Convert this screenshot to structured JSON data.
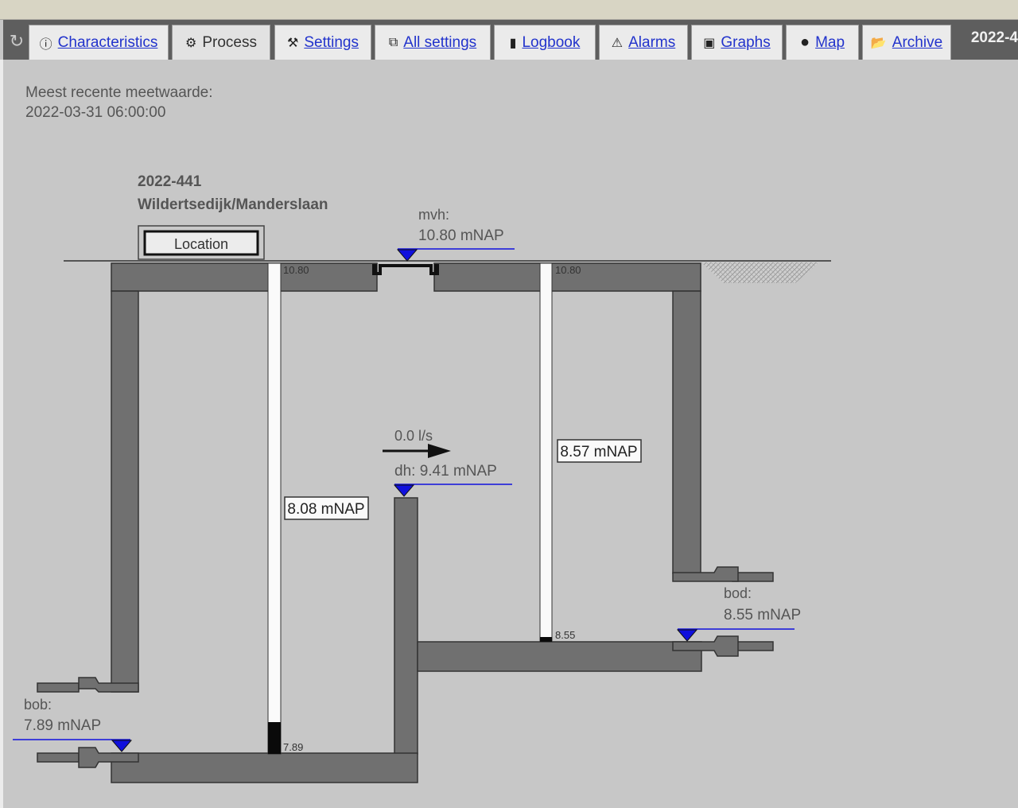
{
  "tabs": [
    {
      "label": "Characteristics",
      "icon": "info-icon",
      "active": false
    },
    {
      "label": "Process",
      "icon": "gear-icon",
      "active": true
    },
    {
      "label": "Settings",
      "icon": "wrench-icon",
      "active": false
    },
    {
      "label": "All settings",
      "icon": "chain-icon",
      "active": false
    },
    {
      "label": "Logbook",
      "icon": "book-icon",
      "active": false
    },
    {
      "label": "Alarms",
      "icon": "warning-icon",
      "active": false
    },
    {
      "label": "Graphs",
      "icon": "image-icon",
      "active": false
    },
    {
      "label": "Map",
      "icon": "globe-icon",
      "active": false
    },
    {
      "label": "Archive",
      "icon": "folder-icon",
      "active": false
    }
  ],
  "header_code": "2022-4",
  "recent": {
    "label": "Meest recente meetwaarde:",
    "timestamp": "2022-03-31 06:00:00"
  },
  "station": {
    "id": "2022-441",
    "name": "Wildertsedijk/Manderslaan",
    "location_button": "Location"
  },
  "levels": {
    "mvh_label": "mvh:",
    "mvh_value": "10.80 mNAP",
    "top_left": "10.80",
    "top_right": "10.80",
    "left_level": "8.08 mNAP",
    "right_level": "8.57 mNAP",
    "bottom_left": "7.89",
    "bottom_right": "8.55",
    "flow": "0.0 l/s",
    "dh": "dh: 9.41 mNAP",
    "bob_label": "bob:",
    "bob_value": "7.89 mNAP",
    "bod_label": "bod:",
    "bod_value": "8.55 mNAP"
  },
  "colors": {
    "wall": "#707070",
    "marker": "#1010dd",
    "link": "#2233cc",
    "tabbar": "#5e5e5e"
  }
}
